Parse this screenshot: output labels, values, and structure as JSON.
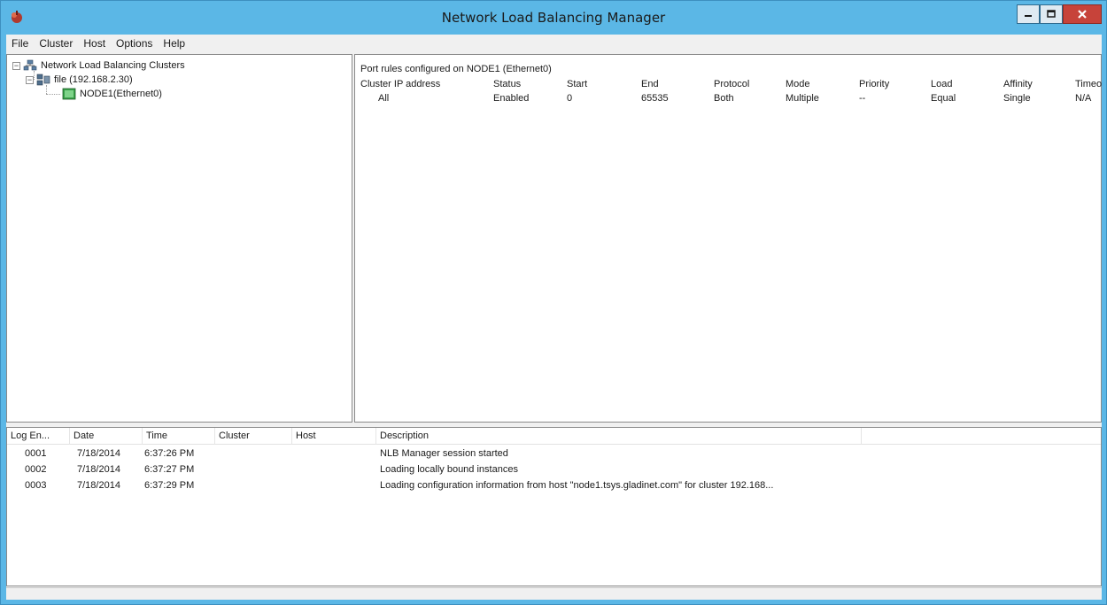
{
  "window": {
    "title": "Network Load Balancing Manager",
    "accent_color": "#5bb7e6",
    "close_color": "#c7433a"
  },
  "menu": [
    "File",
    "Cluster",
    "Host",
    "Options",
    "Help"
  ],
  "tree": {
    "root": "Network Load Balancing Clusters",
    "cluster": "file (192.168.2.30)",
    "node": "NODE1(Ethernet0)"
  },
  "rules": {
    "caption": "Port rules configured on NODE1 (Ethernet0)",
    "columns": [
      "Cluster IP address",
      "Status",
      "Start",
      "End",
      "Protocol",
      "Mode",
      "Priority",
      "Load",
      "Affinity",
      "Timeo"
    ],
    "rows": [
      [
        "All",
        "Enabled",
        "0",
        "65535",
        "Both",
        "Multiple",
        "--",
        "Equal",
        "Single",
        "N/A"
      ]
    ]
  },
  "log": {
    "columns": [
      "Log En...",
      "Date",
      "Time",
      "Cluster",
      "Host",
      "Description"
    ],
    "rows": [
      [
        "0001",
        "7/18/2014",
        "6:37:26 PM",
        "",
        "",
        "NLB Manager session started"
      ],
      [
        "0002",
        "7/18/2014",
        "6:37:27 PM",
        "",
        "",
        "Loading locally bound instances"
      ],
      [
        "0003",
        "7/18/2014",
        "6:37:29 PM",
        "",
        "",
        "Loading configuration information from host \"node1.tsys.gladinet.com\" for cluster 192.168..."
      ]
    ]
  }
}
